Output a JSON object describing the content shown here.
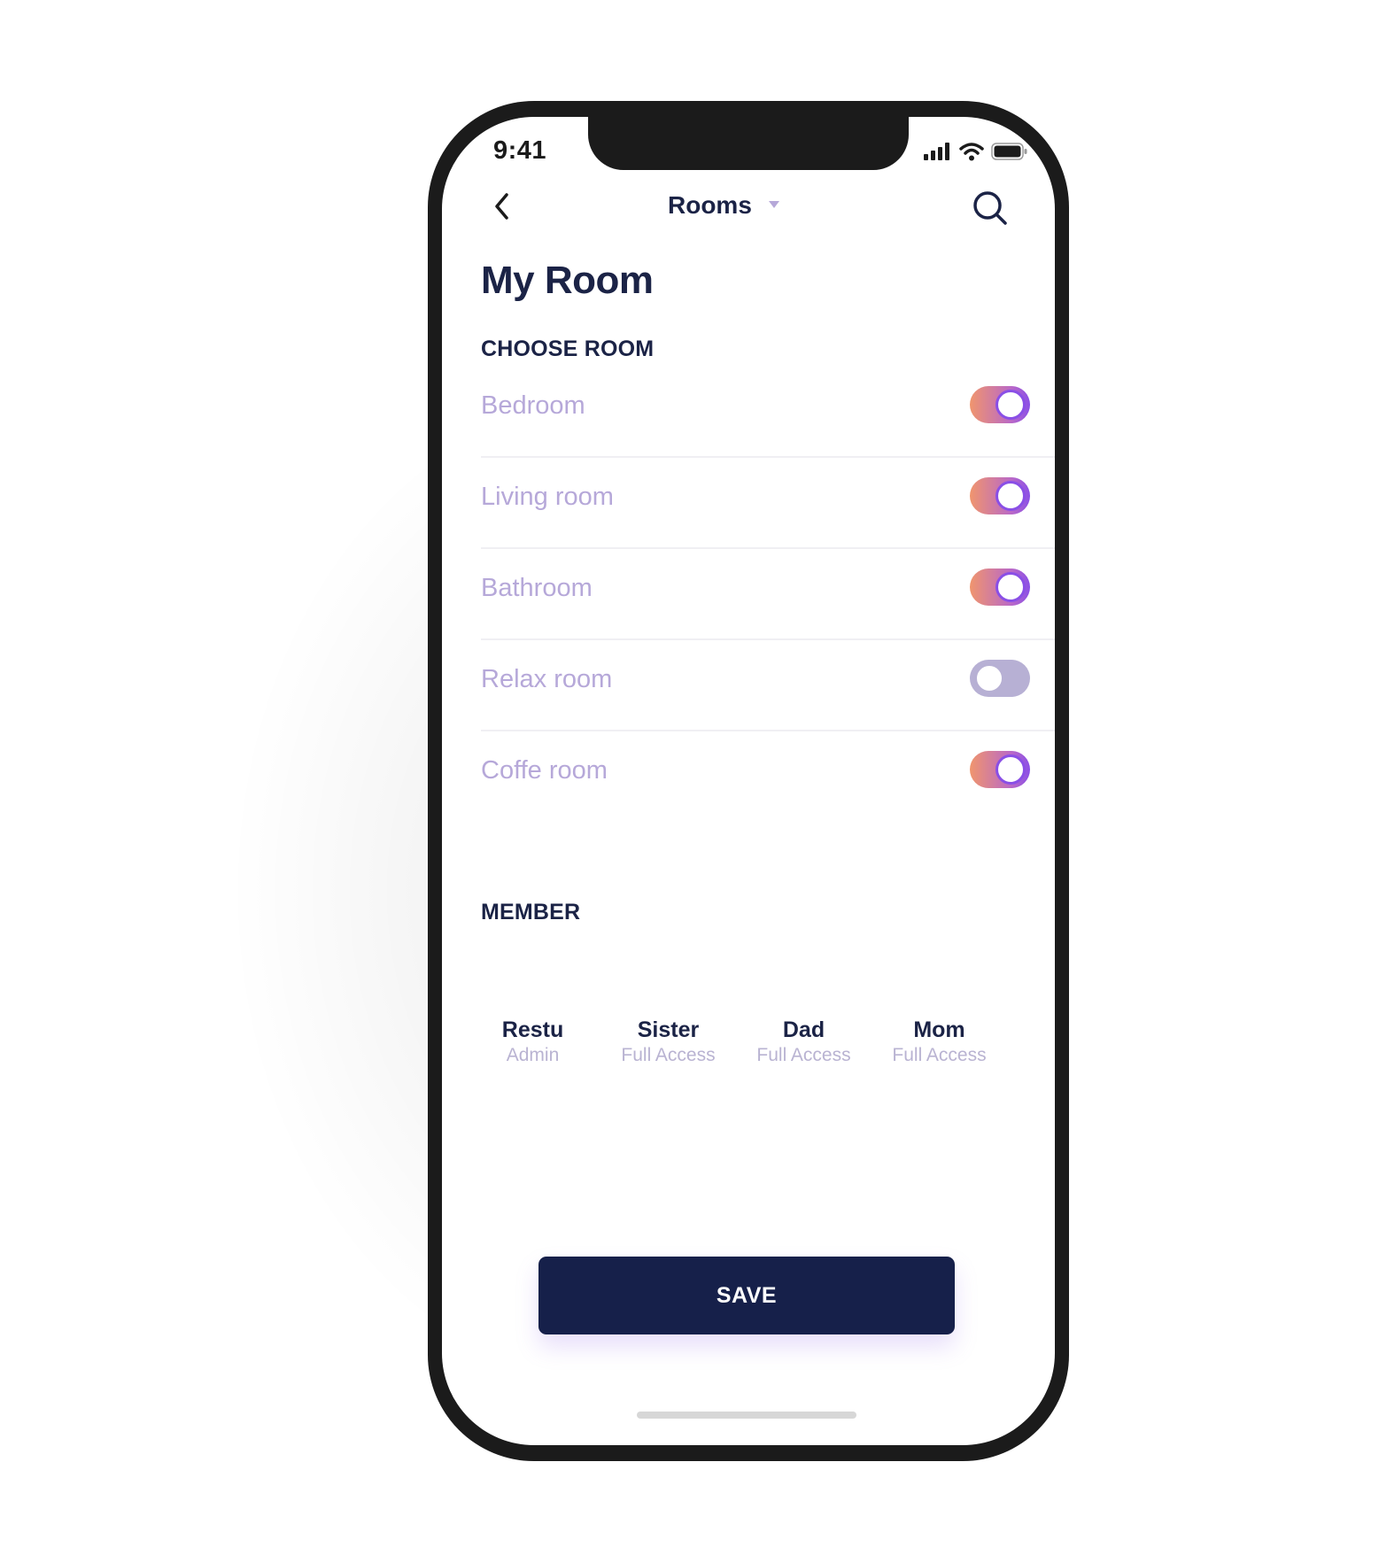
{
  "status_bar": {
    "time": "9:41",
    "icons": [
      "signal-icon",
      "wifi-icon",
      "battery-icon"
    ]
  },
  "nav": {
    "back_icon": "chevron-left-icon",
    "title": "Rooms",
    "dropdown_icon": "caret-down-icon",
    "search_icon": "search-icon"
  },
  "page": {
    "title": "My Room"
  },
  "choose_room": {
    "label": "CHOOSE ROOM",
    "rooms": [
      {
        "name": "Bedroom",
        "enabled": true
      },
      {
        "name": "Living room",
        "enabled": true
      },
      {
        "name": "Bathroom",
        "enabled": true
      },
      {
        "name": "Relax room",
        "enabled": false
      },
      {
        "name": "Coffe room",
        "enabled": true
      }
    ]
  },
  "member": {
    "label": "MEMBER",
    "members": [
      {
        "name": "Restu",
        "role": "Admin"
      },
      {
        "name": "Sister",
        "role": "Full Access"
      },
      {
        "name": "Dad",
        "role": "Full Access"
      },
      {
        "name": "Mom",
        "role": "Full Access"
      }
    ]
  },
  "actions": {
    "save_label": "SAVE"
  },
  "colors": {
    "primary_dark": "#16204a",
    "text_dark": "#1b2346",
    "room_text": "#b6a8d9",
    "toggle_gradient_start": "#f0956d",
    "toggle_gradient_end": "#8a4fe6",
    "toggle_off": "#b7b0d4"
  }
}
